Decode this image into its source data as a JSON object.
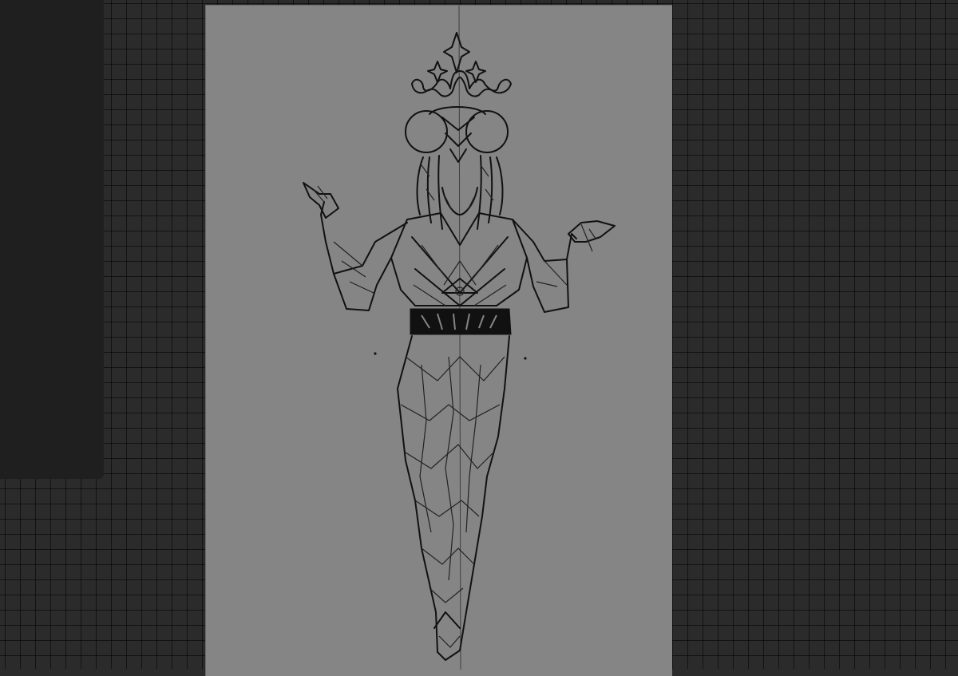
{
  "app": {
    "type": "drawing-canvas",
    "colors": {
      "workspace_bg": "#2b2b2b",
      "grid_line": "#1a1a1a",
      "side_panel": "#1f1f1f",
      "canvas_bg": "#858585",
      "ink": "#111111"
    },
    "icons": {
      "crown": "crown-ornament-icon"
    }
  },
  "canvas": {
    "content": "line-art-figure"
  }
}
